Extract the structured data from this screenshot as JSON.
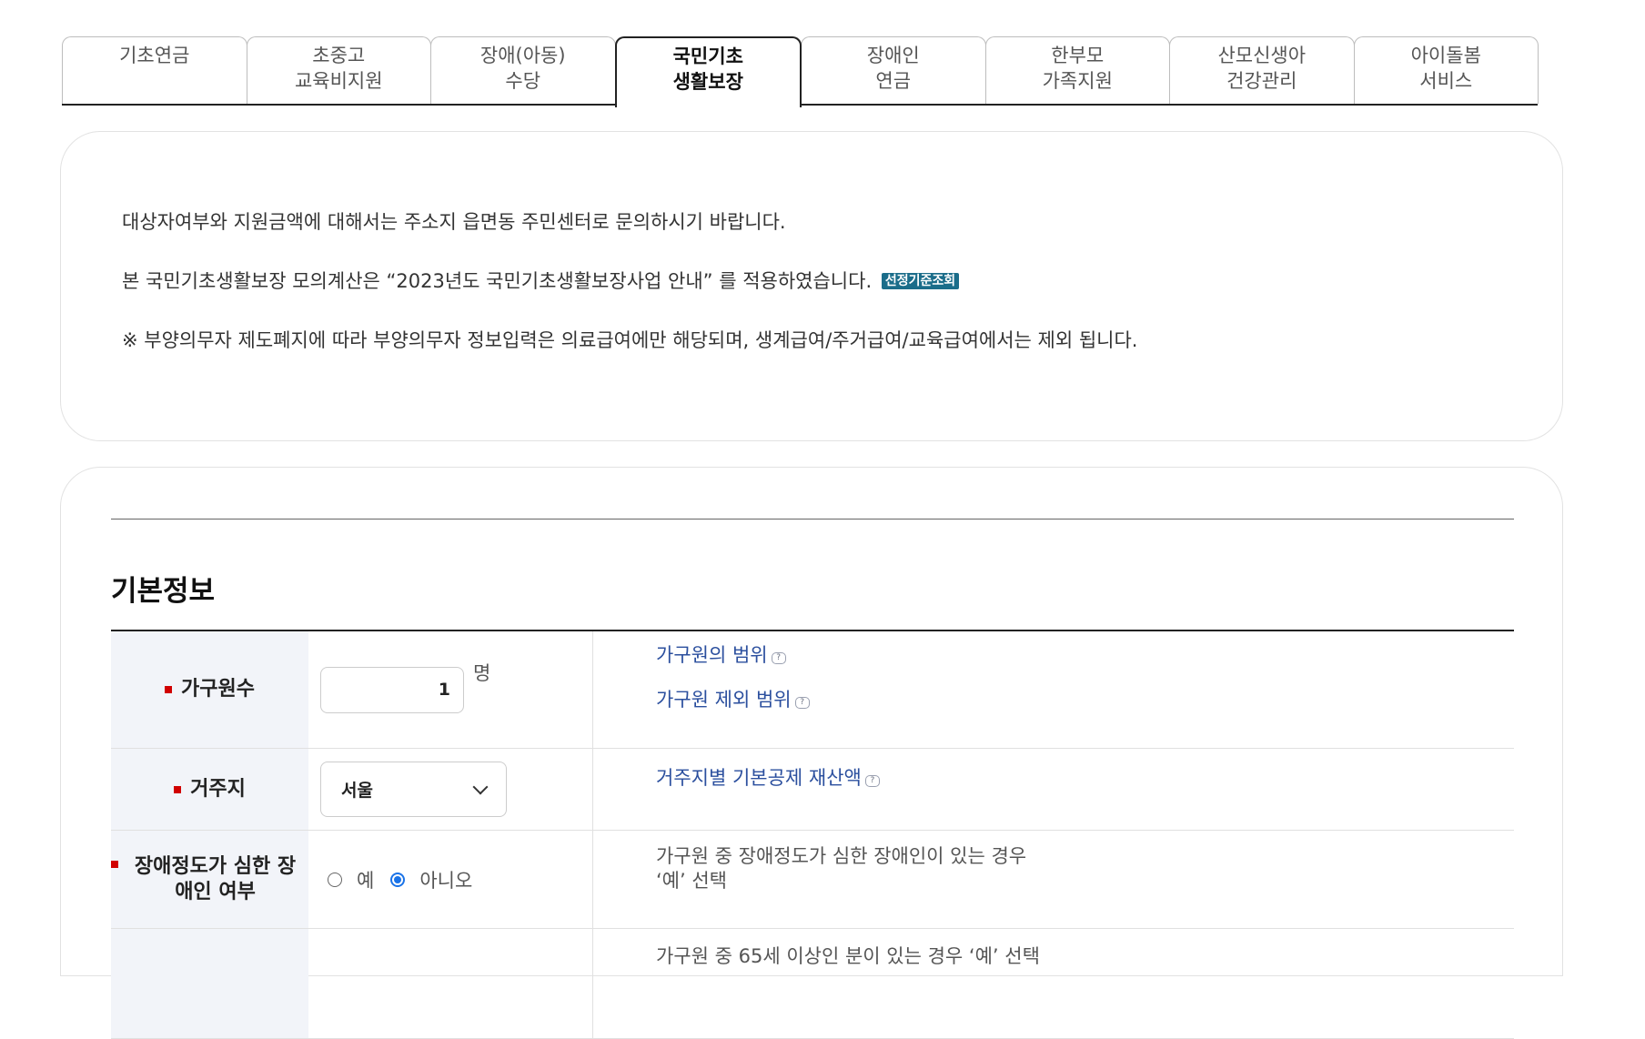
{
  "tabs": [
    {
      "line1": "기초연금",
      "line2": ""
    },
    {
      "line1": "초중고",
      "line2": "교육비지원"
    },
    {
      "line1": "장애(아동)",
      "line2": "수당"
    },
    {
      "line1": "국민기초",
      "line2": "생활보장"
    },
    {
      "line1": "장애인",
      "line2": "연금"
    },
    {
      "line1": "한부모",
      "line2": "가족지원"
    },
    {
      "line1": "산모신생아",
      "line2": "건강관리"
    },
    {
      "line1": "아이돌봄",
      "line2": "서비스"
    }
  ],
  "active_tab_index": 3,
  "notice": {
    "line1": "대상자여부와 지원금액에 대해서는 주소지 읍면동 주민센터로 문의하시기 바랍니다.",
    "line2": "본 국민기초생활보장 모의계산은 “2023년도 국민기초생활보장사업 안내” 를 적용하였습니다.",
    "badge": "선정기준조회",
    "line3": "※ 부양의무자 제도폐지에 따라 부양의무자 정보입력은 의료급여에만 해당되며, 생계급여/주거급여/교육급여에서는 제외 됩니다."
  },
  "section": {
    "title": "기본정보"
  },
  "form": {
    "household": {
      "label": "가구원수",
      "value": "1",
      "unit": "명",
      "link1": "가구원의 범위",
      "link2": "가구원 제외 범위"
    },
    "residence": {
      "label": "거주지",
      "value": "서울",
      "link": "거주지별 기본공제 재산액"
    },
    "disability": {
      "label": "장애정도가 심한 장애인 여부",
      "option_yes": "예",
      "option_no": "아니오",
      "selected": "아니오",
      "info_line1": "가구원 중 장애정도가 심한 장애인이 있는 경우",
      "info_line2": "‘예’ 선택"
    },
    "next_row_info": "가구원 중 65세 이상인 분이 있는 경우 ‘예’ 선택"
  },
  "colors": {
    "link": "#2b4f9e",
    "required_marker": "#d10000",
    "badge": "#1b6d8a",
    "radio_checked": "#1a73e8"
  }
}
